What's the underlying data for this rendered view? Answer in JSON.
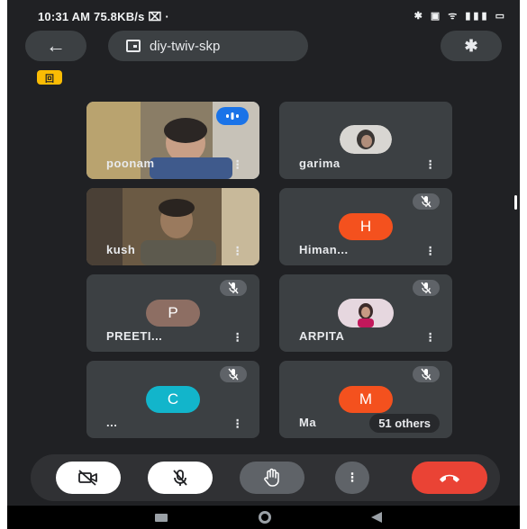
{
  "status": {
    "time": "10:31 AM",
    "speed": "75.8KB/s",
    "icons": "✱ ▣ ᯤ ▮▮▮ ▭"
  },
  "header": {
    "back_glyph": "←",
    "meeting_code": "diy-twiv-skp",
    "bluetooth_glyph": "✱"
  },
  "chip_label": "回",
  "participants": [
    {
      "name": "poonam",
      "kind": "video",
      "active": true
    },
    {
      "name": "garima",
      "kind": "photo"
    },
    {
      "name": "kush",
      "kind": "video"
    },
    {
      "name": "Himan...",
      "kind": "letter",
      "letter": "H",
      "color": "#f4511e",
      "muted": true
    },
    {
      "name": "PREETI...",
      "kind": "letter",
      "letter": "P",
      "color": "#8d6e63",
      "muted": true
    },
    {
      "name": "ARPITA",
      "kind": "photo",
      "muted": true
    },
    {
      "name": "...",
      "kind": "letter",
      "letter": "C",
      "color": "#12b5cb",
      "muted": true
    },
    {
      "name": "Ma",
      "kind": "letter",
      "letter": "M",
      "color": "#f4511e",
      "muted": true,
      "others": "51 others"
    }
  ],
  "menu_glyph": "⁝",
  "colors": {
    "background": "#202124",
    "tile": "#3c4043",
    "accent": "#1a73e8",
    "hangup": "#ea4335"
  }
}
